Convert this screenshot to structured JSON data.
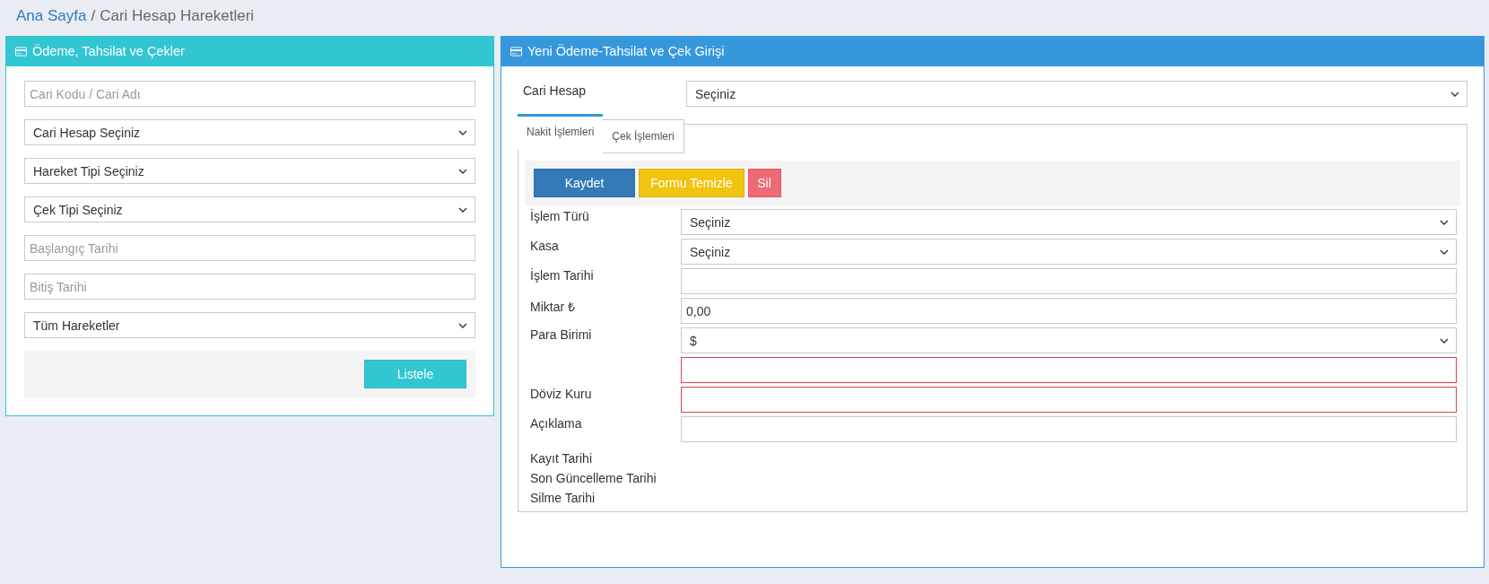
{
  "breadcrumb": {
    "home": "Ana Sayfa",
    "separator": "/",
    "current": "Cari Hesap Hareketleri"
  },
  "filter_panel": {
    "title": "Ödeme, Tahsilat ve Çekler",
    "fields": [
      {
        "kind": "input",
        "placeholder": "Cari Kodu / Cari Adı"
      },
      {
        "kind": "select",
        "value": "Cari Hesap Seçiniz"
      },
      {
        "kind": "select",
        "value": "Hareket Tipi Seçiniz"
      },
      {
        "kind": "select",
        "value": "Çek Tipi Seçiniz"
      },
      {
        "kind": "input",
        "placeholder": "Başlangıç Tarihi"
      },
      {
        "kind": "input",
        "placeholder": "Bitiş Tarihi"
      },
      {
        "kind": "select",
        "value": "Tüm Hareketler"
      }
    ],
    "button": "Listele"
  },
  "entry_panel": {
    "title": "Yeni Ödeme-Tahsilat ve Çek Girişi",
    "account": {
      "label": "Cari Hesap",
      "value": "Seçiniz"
    },
    "tabs": [
      {
        "label": "Nakit İşlemleri",
        "selected": true
      },
      {
        "label": "Çek İşlemleri",
        "selected": false
      }
    ],
    "buttons": [
      {
        "kind": "primary",
        "label": "Kaydet"
      },
      {
        "kind": "warning",
        "label": "Formu Temizle"
      },
      {
        "kind": "danger",
        "label": "Sil"
      }
    ],
    "fields": [
      {
        "label": "İşlem Türü",
        "kind": "select",
        "value": "Seçiniz",
        "invalid": false
      },
      {
        "label": "Kasa",
        "kind": "select",
        "value": "Seçiniz",
        "invalid": false
      },
      {
        "label": "İşlem Tarihi",
        "kind": "input",
        "invalid": false
      },
      {
        "label": "Miktar ₺",
        "kind": "input",
        "value": "0,00",
        "invalid": false
      },
      {
        "label": "Para Birimi",
        "kind": "select",
        "value": "$",
        "invalid": false
      },
      {
        "kind": "input",
        "invalid": true
      },
      {
        "label": "Döviz Kuru",
        "kind": "input",
        "invalid": true
      },
      {
        "label": "Açıklama",
        "kind": "input",
        "invalid": false
      }
    ],
    "info_labels": [
      "Kayıt Tarihi",
      "Son Güncelleme Tarihi",
      "Silme Tarihi"
    ]
  }
}
